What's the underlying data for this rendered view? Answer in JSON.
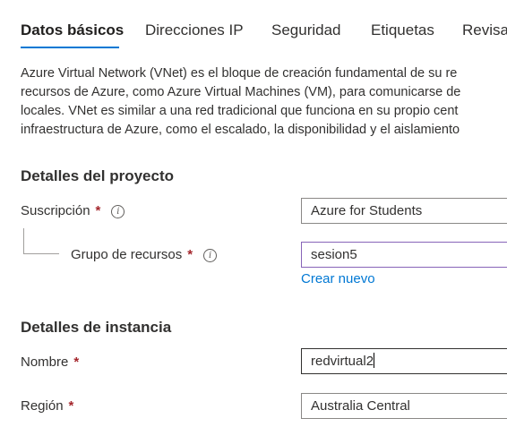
{
  "tabs": [
    {
      "label": "Datos básicos",
      "active": true
    },
    {
      "label": "Direcciones IP",
      "active": false
    },
    {
      "label": "Seguridad",
      "active": false
    },
    {
      "label": "Etiquetas",
      "active": false
    },
    {
      "label": "Revisa",
      "active": false
    }
  ],
  "description": {
    "lines": [
      "Azure Virtual Network (VNet) es el bloque de creación fundamental de su re",
      "recursos de Azure, como Azure Virtual Machines (VM), para comunicarse de",
      "locales. VNet es similar a una red tradicional que funciona en su propio cent",
      "infraestructura de Azure, como el escalado, la disponibilidad y el aislamiento"
    ]
  },
  "project": {
    "title": "Detalles del proyecto",
    "subscription": {
      "label": "Suscripción",
      "required_mark": "*",
      "info_icon": "info-icon",
      "value": "Azure for Students"
    },
    "resource_group": {
      "label": "Grupo de recursos",
      "required_mark": "*",
      "info_icon": "info-icon",
      "value": "sesion5",
      "create_new_link": "Crear nuevo"
    }
  },
  "instance": {
    "title": "Detalles de instancia",
    "name": {
      "label": "Nombre",
      "required_mark": "*",
      "value": "redvirtual2"
    },
    "region": {
      "label": "Región",
      "required_mark": "*",
      "value": "Australia Central"
    }
  },
  "colors": {
    "accent": "#0078d4",
    "required": "#a4262c",
    "focus_border": "#8764b8"
  }
}
